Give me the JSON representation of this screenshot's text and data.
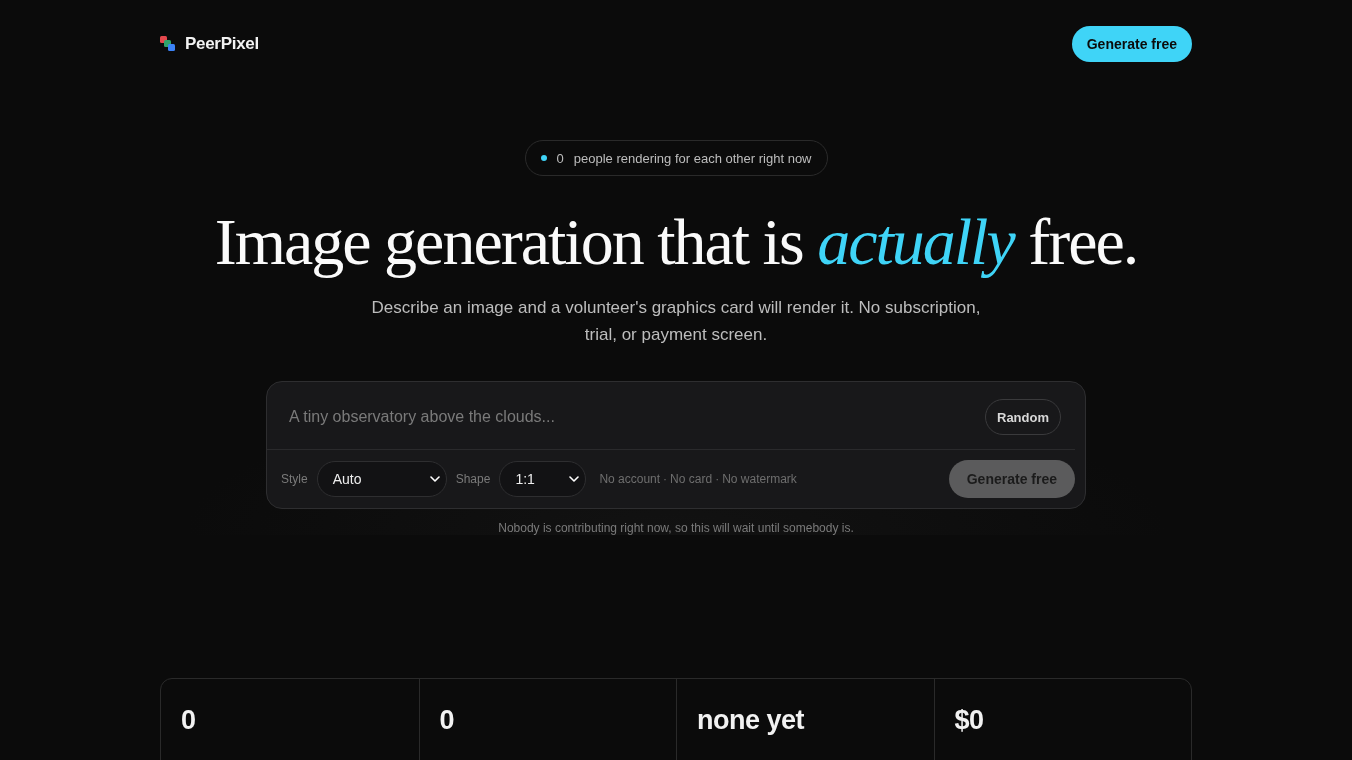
{
  "nav": {
    "brand": "PeerPixel",
    "cta": "Generate free"
  },
  "presence": {
    "count": "0",
    "text": "people rendering for each other right now"
  },
  "headline": "Image generation that is *actually* free.",
  "subtitle": "Describe an image and a volunteer's graphics card will render it. No subscription, trial, or payment screen.",
  "prompt": {
    "placeholder": "A tiny observatory above the clouds...",
    "random": "Random",
    "style": {
      "label": "Style",
      "value": "Auto"
    },
    "shape": {
      "label": "Shape",
      "value": "1:1"
    },
    "assurances": [
      "No account",
      "No card",
      "No watermark"
    ],
    "separator": "·",
    "submit": {
      "label": "Generate free",
      "disabled": true
    }
  },
  "notice": "Nobody is contributing right now, so this will wait until somebody is.",
  "stats": [
    "0",
    "0",
    "none yet",
    "$0"
  ]
}
